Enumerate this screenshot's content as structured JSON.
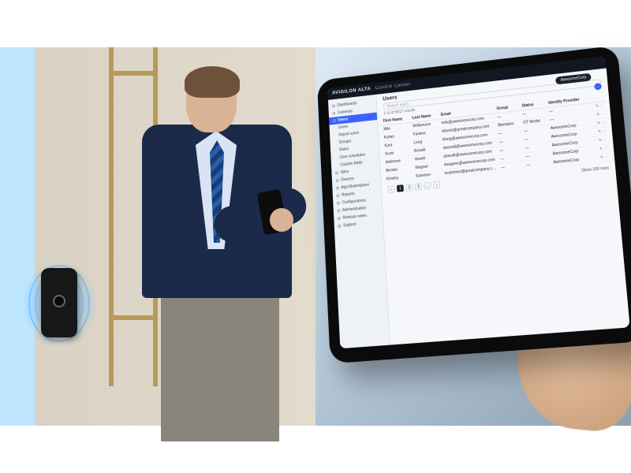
{
  "scene": {
    "left": {
      "subject": "Man in navy suit using phone near glass door with access-control reader"
    },
    "right": {
      "subject": "Tablet held in hand showing Avigilon Alta Control Center – Users screen"
    }
  },
  "app": {
    "brand": "AVIGILON ALTA",
    "brand_sub": "Control Center",
    "header_pill": "AwesomeCorp",
    "page_title": "Users",
    "search_placeholder": "Search users",
    "result_count": "1–6 of 5617 results",
    "show_rows": "Show 100 rows"
  },
  "sidebar": {
    "items": [
      {
        "label": "Dashboards"
      },
      {
        "label": "Cameras"
      },
      {
        "label": "Users",
        "selected": true
      },
      {
        "label": "Users",
        "sub": true
      },
      {
        "label": "Import users",
        "sub": true
      },
      {
        "label": "Groups",
        "sub": true
      },
      {
        "label": "Roles",
        "sub": true
      },
      {
        "label": "User schedules",
        "sub": true
      },
      {
        "label": "Custom fields",
        "sub": true
      },
      {
        "label": "Sites"
      },
      {
        "label": "Devices"
      },
      {
        "label": "App Marketplace"
      },
      {
        "label": "Reports"
      },
      {
        "label": "Configurations"
      },
      {
        "label": "Administration"
      },
      {
        "label": "Release notes"
      },
      {
        "label": "Support"
      }
    ]
  },
  "table": {
    "columns": [
      "First Name",
      "Last Name",
      "Email",
      "Group",
      "Status",
      "Identity Provider",
      ""
    ],
    "rows": [
      {
        "first": "Milo",
        "last": "Williamson",
        "email": "milo@awesomecorp.com",
        "group": "—",
        "status": "—",
        "idp": "—"
      },
      {
        "first": "Kylian",
        "last": "Farsina",
        "email": "kfarsin@greatcompany.com",
        "group": "Members",
        "status": "OT Model",
        "idp": "—"
      },
      {
        "first": "Kyra",
        "last": "Long",
        "email": "klong@awesomecorp.com",
        "group": "—",
        "status": "—",
        "idp": "AwesomeCorp"
      },
      {
        "first": "Scott",
        "last": "Bonelli",
        "email": "sbonelli@awesomecorp.com",
        "group": "—",
        "status": "—",
        "idp": "AwesomeCorp"
      },
      {
        "first": "Adrienne",
        "last": "Hewitt",
        "email": "ahewitt@awesomecorp.com",
        "group": "—",
        "status": "—",
        "idp": "AwesomeCorp"
      },
      {
        "first": "Brooks",
        "last": "Wagner",
        "email": "bwagner@awesomecorp.com",
        "group": "—",
        "status": "—",
        "idp": "AwesomeCorp"
      },
      {
        "first": "Kinsley",
        "last": "Solomon",
        "email": "ksolomon@greatcompany.com",
        "group": "—",
        "status": "—",
        "idp": "AwesomeCorp"
      }
    ]
  },
  "pager": {
    "pages": [
      "‹",
      "1",
      "2",
      "3",
      "…",
      "›"
    ],
    "current": "1"
  }
}
